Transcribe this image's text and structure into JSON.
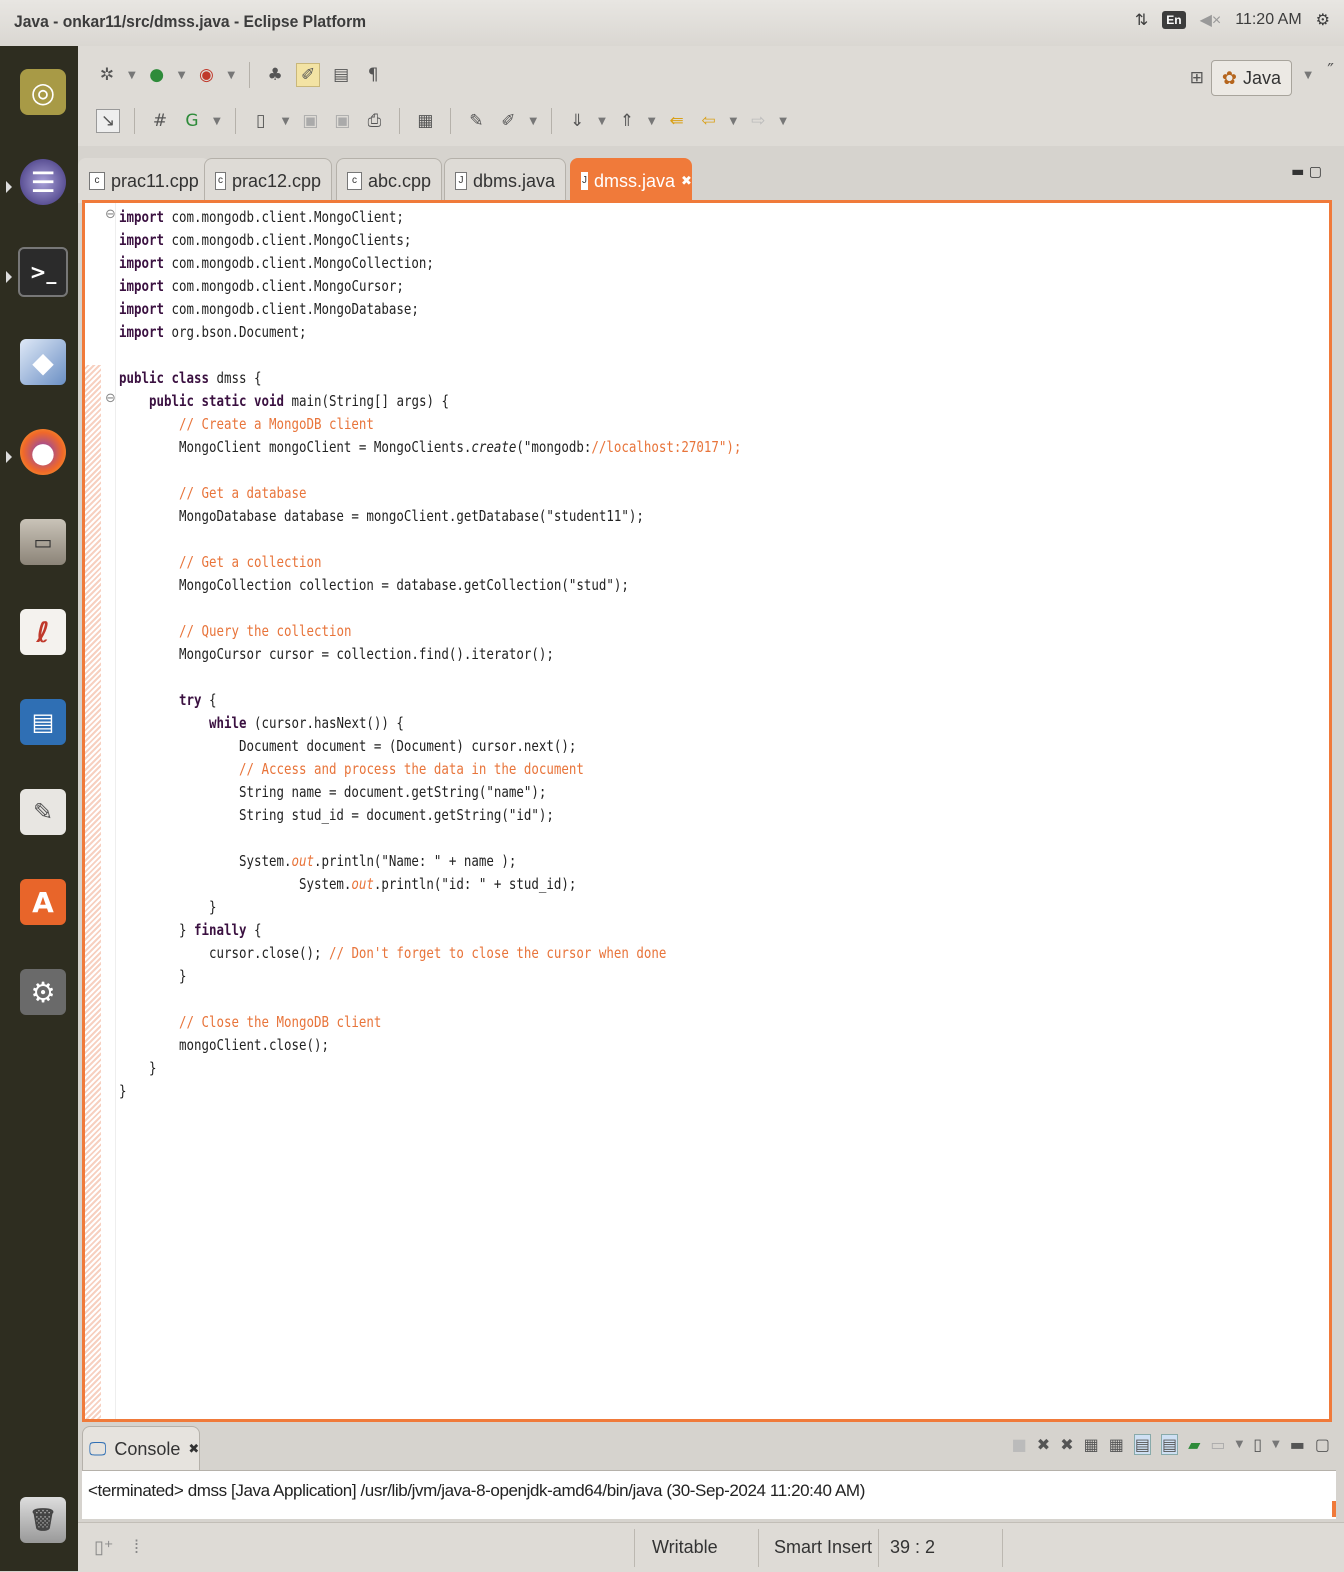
{
  "window": {
    "title": "Java - onkar11/src/dmss.java - Eclipse Platform"
  },
  "tray": {
    "keyboard": "En",
    "volume_icon": "speaker-icon",
    "time": "11:20 AM",
    "settings_icon": "gear-icon"
  },
  "launcher": [
    "ubuntu-dash-icon",
    "eclipse-icon",
    "terminal-icon",
    "virtualbox-icon",
    "firefox-icon",
    "files-icon",
    "pdf-reader-icon",
    "writer-icon",
    "text-editor-icon",
    "software-center-icon",
    "system-settings-icon",
    "trash-icon"
  ],
  "perspective": {
    "label": "Java"
  },
  "tabs": [
    {
      "label": "prac11.cpp",
      "icon": "c"
    },
    {
      "label": "prac12.cpp",
      "icon": "c"
    },
    {
      "label": "abc.cpp",
      "icon": "c"
    },
    {
      "label": "dbms.java",
      "icon": "J"
    },
    {
      "label": "dmss.java",
      "icon": "J",
      "active": true,
      "close": "✖"
    }
  ],
  "code": [
    "import com.mongodb.client.MongoClient;",
    "import com.mongodb.client.MongoClients;",
    "import com.mongodb.client.MongoCollection;",
    "import com.mongodb.client.MongoCursor;",
    "import com.mongodb.client.MongoDatabase;",
    "import org.bson.Document;",
    "",
    "public class dmss {",
    "    public static void main(String[] args) {",
    "        // Create a MongoDB client",
    "        MongoClient mongoClient = MongoClients.create(\"mongodb://localhost:27017\");",
    "",
    "        // Get a database",
    "        MongoDatabase database = mongoClient.getDatabase(\"student11\");",
    "",
    "        // Get a collection",
    "        MongoCollection collection = database.getCollection(\"stud\");",
    "",
    "        // Query the collection",
    "        MongoCursor cursor = collection.find().iterator();",
    "",
    "        try {",
    "            while (cursor.hasNext()) {",
    "                Document document = (Document) cursor.next();",
    "                // Access and process the data in the document",
    "                String name = document.getString(\"name\");",
    "                String stud_id = document.getString(\"id\");",
    "",
    "                System.out.println(\"Name: \" + name );",
    "                        System.out.println(\"id: \" + stud_id);",
    "            }",
    "        } finally {",
    "            cursor.close(); // Don't forget to close the cursor when done",
    "        }",
    "",
    "        // Close the MongoDB client",
    "        mongoClient.close();",
    "    }",
    "}"
  ],
  "console": {
    "tab_label": "Console",
    "output": "<terminated> dmss [Java Application] /usr/lib/jvm/java-8-openjdk-amd64/bin/java (30-Sep-2024 11:20:40 AM)"
  },
  "status": {
    "writable": "Writable",
    "insert_mode": "Smart Insert",
    "position": "39 : 2"
  }
}
